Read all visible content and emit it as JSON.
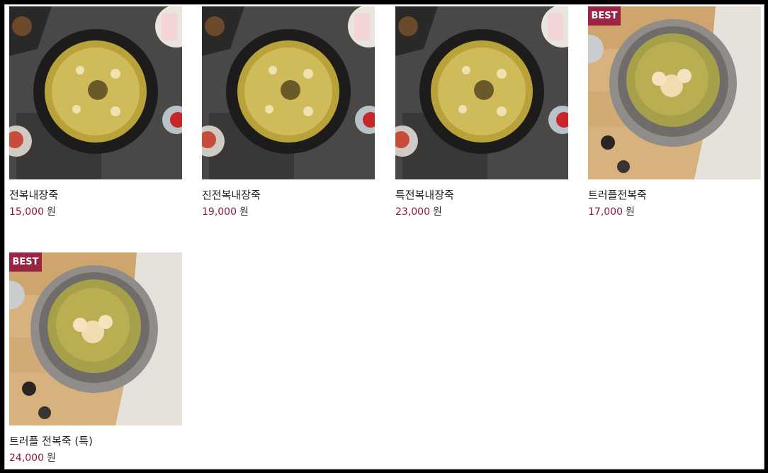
{
  "products": [
    {
      "name": "전복내장죽",
      "price": "15,000",
      "unit": "원",
      "badge": "",
      "theme": "dark"
    },
    {
      "name": "진전복내장죽",
      "price": "19,000",
      "unit": "원",
      "badge": "",
      "theme": "dark"
    },
    {
      "name": "특전복내장죽",
      "price": "23,000",
      "unit": "원",
      "badge": "",
      "theme": "dark"
    },
    {
      "name": "트러플전복죽",
      "price": "17,000",
      "unit": "원",
      "badge": "BEST",
      "theme": "wood"
    },
    {
      "name": "트러플 전복죽 (특)",
      "price": "24,000",
      "unit": "원",
      "badge": "BEST",
      "theme": "wood"
    }
  ],
  "colors": {
    "price": "#8b1a3c",
    "badge": "#9b2343"
  }
}
